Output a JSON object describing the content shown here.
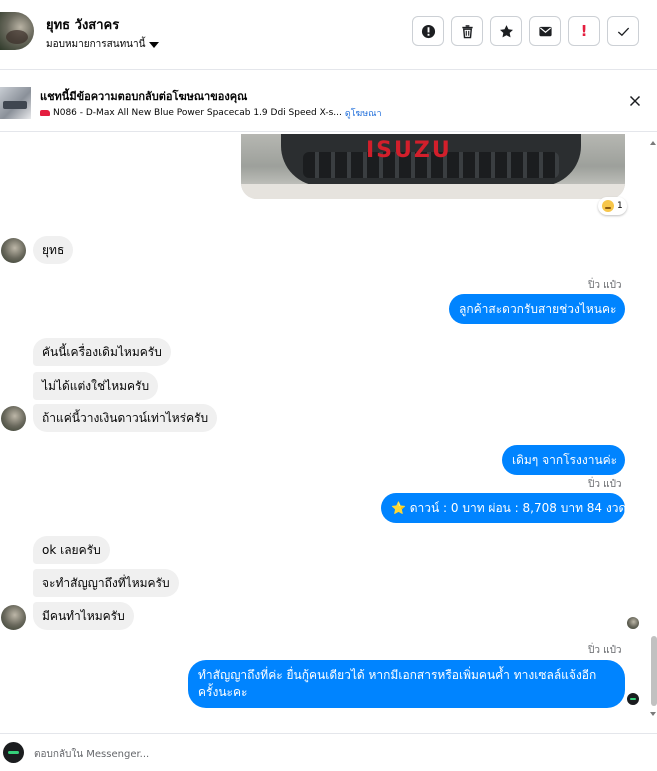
{
  "header": {
    "contact_name": "ยุทธ วังสาคร",
    "assign_label": "มอบหมายการสนทนานี้",
    "actions": [
      {
        "name": "report",
        "icon": "info-circle-icon"
      },
      {
        "name": "delete",
        "icon": "trash-icon"
      },
      {
        "name": "star",
        "icon": "star-icon"
      },
      {
        "name": "mark-unread",
        "icon": "envelope-icon"
      },
      {
        "name": "spam",
        "icon": "exclamation-icon",
        "label": "!"
      },
      {
        "name": "done",
        "icon": "check-icon"
      }
    ]
  },
  "ad": {
    "title": "แชทนี้มีข้อความตอบกลับต่อโฆษณาของคุณ",
    "listing": "N086 - D-Max All New Blue Power Spacecab 1.9 Ddi Speed X-s...",
    "view_link": "ดูโฆษณา"
  },
  "image_message": {
    "logo_text": "ISUZU",
    "reaction_count": "1"
  },
  "messages": {
    "m1": "ยุทธ",
    "sender1": "ปิ่ว แป๋ว",
    "m2": "ลูกค้าสะดวกรับสายช่วงไหนคะ",
    "m3": "คันนี้เครื่องเดิมไหมครับ",
    "m4": "ไม่ได้แต่งใช่ไหมครับ",
    "m5": "ถ้าแค่นี้วางเงินดาวน์เท่าไหร่ครับ",
    "m6": "เดิมๆ จากโรงงานค่ะ",
    "sender2": "ปิ่ว แป๋ว",
    "m7": "⭐ ดาวน์ : 0 บาท ผ่อน : 8,708 บาท 84 งวด",
    "m8": "ok เลยครับ",
    "m9": "จะทำสัญญาถึงที่ไหมครับ",
    "m10": "มีคนทำไหมครับ",
    "sender3": "ปิ่ว แป๋ว",
    "m11_line1": "ทำสัญญาถึงที่ค่ะ  ยื่นกู้คนเดียวได้ หากมีเอกสารหรือเพิ่มคนค้ำ ทางเซลล์แจ้งอีก",
    "m11_line2": "ครั้งนะคะ"
  },
  "composer": {
    "placeholder": "ตอบกลับใน Messenger..."
  },
  "colors": {
    "outgoing_bubble": "#0084ff",
    "incoming_bubble": "#f0f0f0",
    "link": "#216fdb",
    "spam_red": "#e41e3f"
  }
}
